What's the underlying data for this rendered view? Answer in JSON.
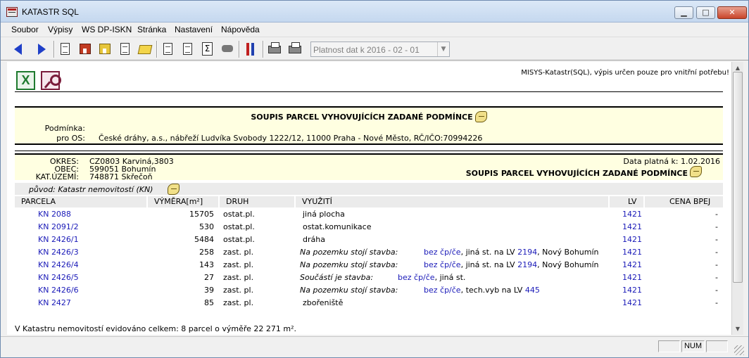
{
  "window": {
    "title": "KATASTR SQL"
  },
  "menu": [
    "Soubor",
    "Výpisy",
    "WS DP-ISKN",
    "Stránka",
    "Nastavení",
    "Nápověda"
  ],
  "toolbar": {
    "icons": [
      "back-arrow-icon",
      "forward-arrow-icon",
      "document-icon",
      "house-red-icon",
      "house-yellow-icon",
      "document-copy-icon",
      "folder-icon",
      "report-icon",
      "report-list-icon",
      "sum-icon",
      "binoculars-icon",
      "tools-icon",
      "print-red-icon",
      "printer-icon"
    ],
    "date_combo": "Platnost dat k 2016 - 02 - 01"
  },
  "report": {
    "disclaimer": "MISYS-Katastr(SQL), výpis určen pouze pro vnitřní potřebu!",
    "condition_title": "SOUPIS PARCEL VYHOVUJÍCÍCH ZADANÉ PODMÍNCE",
    "condition_label": "Podmínka:",
    "for_label": "pro OS:",
    "for_value": "České dráhy, a.s., nábřeží Ludvíka Svobody 1222/12, 11000 Praha - Nové Město, RČ/IČO:70994226",
    "okres_label": "OKRES:",
    "okres_value": "CZ0803 Karviná,3803",
    "obec_label": "OBEC:",
    "obec_value": "599051 Bohumín",
    "ku_label": "KAT.ÚZEMÍ:",
    "ku_value": "748871 Skřečoň",
    "date_valid": "Data platná k: 1.02.2016",
    "list_title": "SOUPIS PARCEL VYHOVUJÍCÍCH ZADANÉ PODMÍNCE",
    "origin": "původ: Katastr nemovitostí (KN)",
    "columns": [
      "PARCELA",
      "VÝMĚRA[m²]",
      "DRUH",
      "VYUŽITÍ",
      "LV",
      "CENA BPEJ"
    ],
    "rows": [
      {
        "parcela": "KN 2088",
        "vymera": "15705",
        "druh": "ostat.pl.",
        "vyuziti": "jiná plocha",
        "lv": "1421",
        "cena": "-"
      },
      {
        "parcela": "KN 2091/2",
        "vymera": "530",
        "druh": "ostat.pl.",
        "vyuziti": "ostat.komunikace",
        "lv": "1421",
        "cena": "-"
      },
      {
        "parcela": "KN 2426/1",
        "vymera": "5484",
        "druh": "ostat.pl.",
        "vyuziti": "dráha",
        "lv": "1421",
        "cena": "-"
      },
      {
        "parcela": "KN 2426/3",
        "vymera": "258",
        "druh": "zast. pl.",
        "vyuziti_prefix": "Na pozemku stojí stavba:",
        "vyuziti_link1": "bez čp/če",
        "vyuziti_mid": ", jiná st. na LV ",
        "vyuziti_link2": "2194",
        "vyuziti_suffix": ", Nový Bohumín",
        "lv": "1421",
        "cena": "-"
      },
      {
        "parcela": "KN 2426/4",
        "vymera": "143",
        "druh": "zast. pl.",
        "vyuziti_prefix": "Na pozemku stojí stavba:",
        "vyuziti_link1": "bez čp/če",
        "vyuziti_mid": ", jiná st. na LV ",
        "vyuziti_link2": "2194",
        "vyuziti_suffix": ", Nový Bohumín",
        "lv": "1421",
        "cena": "-"
      },
      {
        "parcela": "KN 2426/5",
        "vymera": "27",
        "druh": "zast. pl.",
        "vyuziti_prefix": "Součástí je stavba:",
        "vyuziti_link1": "bez čp/če",
        "vyuziti_mid": ", jiná st.",
        "lv": "1421",
        "cena": "-"
      },
      {
        "parcela": "KN 2426/6",
        "vymera": "39",
        "druh": "zast. pl.",
        "vyuziti_prefix": "Na pozemku stojí stavba:",
        "vyuziti_link1": "bez čp/če",
        "vyuziti_mid": ", tech.vyb na LV ",
        "vyuziti_link2": "445",
        "lv": "1421",
        "cena": "-"
      },
      {
        "parcela": "KN 2427",
        "vymera": "85",
        "druh": "zast. pl.",
        "vyuziti": "zbořeniště",
        "lv": "1421",
        "cena": "-"
      }
    ],
    "summary": "V Katastru nemovitostí evidováno celkem: 8 parcel o výměře 22 271 m²."
  },
  "statusbar": {
    "num": "NUM"
  },
  "colors": {
    "link": "#1a1ab8",
    "report_bg": "#ffffe1",
    "header_bg": "#ebebeb"
  }
}
